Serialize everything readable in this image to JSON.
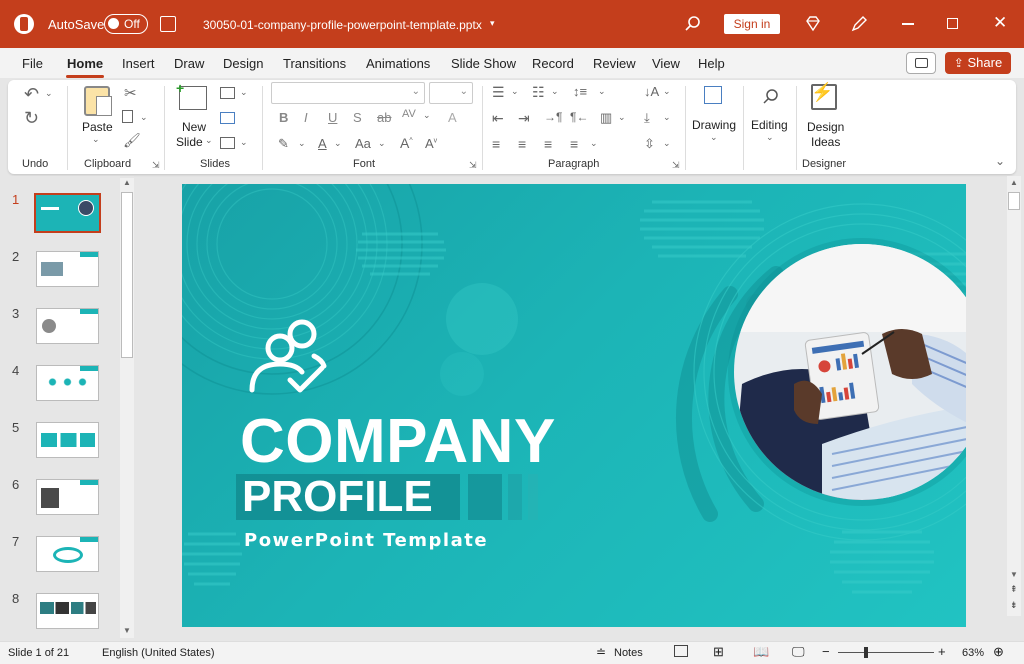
{
  "titlebar": {
    "autosave_label": "AutoSave",
    "autosave_state": "Off",
    "filename": "30050-01-company-profile-powerpoint-template.pptx",
    "signin_label": "Sign in"
  },
  "menu": {
    "items": [
      "File",
      "Home",
      "Insert",
      "Draw",
      "Design",
      "Transitions",
      "Animations",
      "Slide Show",
      "Record",
      "Review",
      "View",
      "Help"
    ],
    "active": "Home",
    "share_label": "Share"
  },
  "ribbon": {
    "undo_group": "Undo",
    "clipboard_group": "Clipboard",
    "paste_label": "Paste",
    "slides_group": "Slides",
    "new_slide_line1": "New",
    "new_slide_line2": "Slide",
    "font_group": "Font",
    "paragraph_group": "Paragraph",
    "drawing_label": "Drawing",
    "editing_label": "Editing",
    "design_ideas_line1": "Design",
    "design_ideas_line2": "Ideas",
    "designer_group": "Designer"
  },
  "thumbnails": {
    "numbers": [
      "1",
      "2",
      "3",
      "4",
      "5",
      "6",
      "7",
      "8"
    ],
    "selected": "1"
  },
  "slide": {
    "title_line1": "COMPANY",
    "title_line2": "PROFILE",
    "subtitle": "PowerPoint Template"
  },
  "status": {
    "slide_counter": "Slide 1 of 21",
    "language": "English (United States)",
    "notes_label": "Notes",
    "zoom": "63%"
  },
  "colors": {
    "accent": "#c43e1c",
    "slide_teal": "#1cb4b6"
  }
}
